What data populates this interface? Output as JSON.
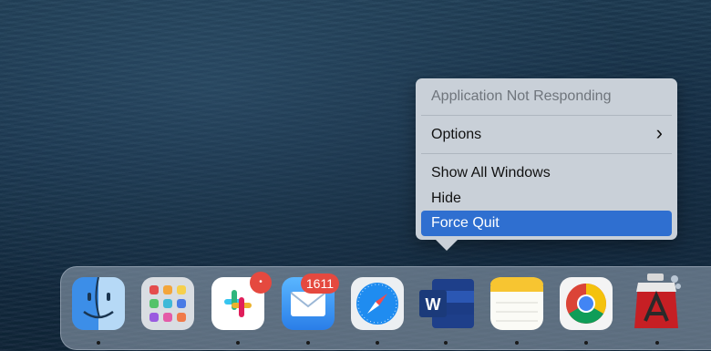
{
  "context_menu": {
    "title": "Application Not Responding",
    "items": [
      {
        "label": "Options",
        "submenu_glyph": "›"
      },
      {
        "label": "Show All Windows"
      },
      {
        "label": "Hide"
      },
      {
        "label": "Force Quit"
      }
    ],
    "highlighted_item": "Force Quit",
    "highlight_color": "#2f6fd0"
  },
  "dock": {
    "apps": [
      {
        "icon": "finder-icon",
        "running": true
      },
      {
        "icon": "launchpad-icon",
        "running": false
      },
      {
        "icon": "slack-icon",
        "running": true,
        "badge": "•"
      },
      {
        "icon": "mail-icon",
        "running": true,
        "badge": "1611"
      },
      {
        "icon": "safari-icon",
        "running": true
      },
      {
        "icon": "word-icon",
        "running": true
      },
      {
        "icon": "notes-icon",
        "running": true
      },
      {
        "icon": "chrome-icon",
        "running": true
      },
      {
        "icon": "acrobat-icon",
        "running": true
      }
    ]
  }
}
